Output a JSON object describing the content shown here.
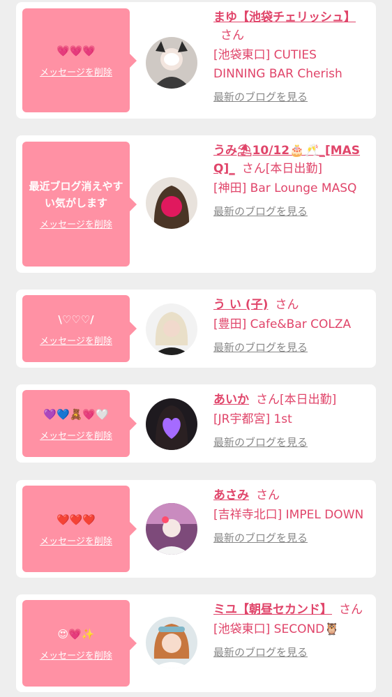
{
  "cards": [
    {
      "message": "💗💗💗",
      "delete_label": "メッセージを削除",
      "name": "まゆ【池袋チェリッシュ】",
      "honorific": "さん",
      "shop": "[池袋東口] CUTIES DINNING BAR Cherish",
      "blog_label": "最新のブログを見る"
    },
    {
      "message": "最近ブログ消えやすい気がします",
      "delete_label": "メッセージを削除",
      "name": "うみ⛱10/12🎂🥂_[MASQ]_",
      "honorific": "さん[本日出勤]",
      "shop": "[神田] Bar Lounge MASQ",
      "blog_label": "最新のブログを見る"
    },
    {
      "message": "\\♡♡♡/",
      "delete_label": "メッセージを削除",
      "name": "う い (子)",
      "honorific": "さん",
      "shop": "[豊田] Cafe&Bar COLZA",
      "blog_label": "最新のブログを見る"
    },
    {
      "message": "💜💙🧸💗🤍",
      "delete_label": "メッセージを削除",
      "name": "あいか",
      "honorific": "さん[本日出勤]",
      "shop": "[JR宇都宮] 1st",
      "blog_label": "最新のブログを見る"
    },
    {
      "message": "❤️❤️❤️",
      "delete_label": "メッセージを削除",
      "name": "あさみ",
      "honorific": "さん",
      "shop": "[吉祥寺北口] IMPEL DOWN",
      "blog_label": "最新のブログを見る"
    },
    {
      "message": "😍💗✨",
      "delete_label": "メッセージを削除",
      "name": "ミユ【朝昼セカンド】",
      "honorific": "さん",
      "shop": "[池袋東口] SECOND🦉",
      "blog_label": "最新のブログを見る"
    }
  ],
  "colors": {
    "accent": "#e0456a",
    "bubble": "#ff91a4",
    "link_gray": "#888888",
    "background": "#eeeeee"
  },
  "icons": [
    "profile-photo-avatar"
  ]
}
